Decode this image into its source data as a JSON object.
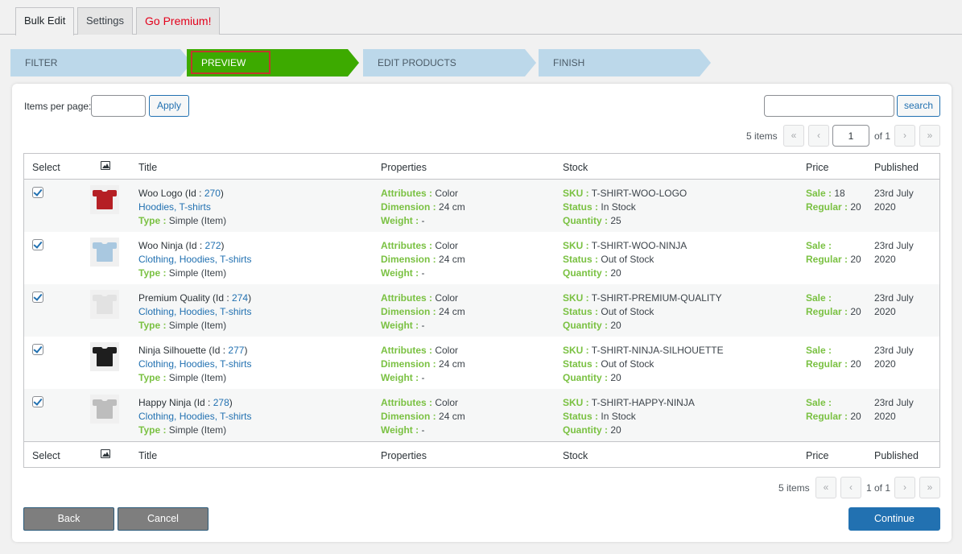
{
  "tabs": [
    {
      "label": "Bulk Edit",
      "active": true
    },
    {
      "label": "Settings",
      "active": false
    },
    {
      "label": "Go Premium!",
      "active": false
    }
  ],
  "steps": [
    {
      "label": "FILTER",
      "state": "inactive"
    },
    {
      "label": "PREVIEW",
      "state": "active"
    },
    {
      "label": "EDIT PRODUCTS",
      "state": "inactive"
    },
    {
      "label": "FINISH",
      "state": "inactive"
    }
  ],
  "controls": {
    "items_per_page_label": "Items per page:",
    "items_per_page_value": "",
    "apply_label": "Apply",
    "search_value": "",
    "search_label": "search"
  },
  "pagination_top": {
    "count": "5 items",
    "first": "«",
    "prev": "‹",
    "page_value": "1",
    "of_text": "of 1",
    "next": "›",
    "last": "»"
  },
  "pagination_bottom": {
    "count": "5 items",
    "first": "«",
    "prev": "‹",
    "page_text": "1 of 1",
    "next": "›",
    "last": "»"
  },
  "table": {
    "headers": {
      "select": "Select",
      "image_icon": "image-icon",
      "title": "Title",
      "properties": "Properties",
      "stock": "Stock",
      "price": "Price",
      "published": "Published"
    },
    "labels": {
      "id_open": "(Id : ",
      "id_close": ")",
      "type": "Type :",
      "attributes": "Attributes :",
      "dimension": "Dimension :",
      "weight": "Weight :",
      "sku": "SKU :",
      "status": "Status :",
      "quantity": "Quantity :",
      "sale": "Sale :",
      "regular": "Regular :"
    },
    "rows": [
      {
        "checked": true,
        "shirt_color": "#b51f24",
        "name": "Woo Logo",
        "id": "270",
        "categories": "Hoodies, T-shirts",
        "type": "Simple (Item)",
        "attributes": "Color",
        "dimension": "24 cm",
        "weight": "-",
        "sku": "T-SHIRT-WOO-LOGO",
        "status": "In Stock",
        "quantity": "25",
        "sale": "18",
        "regular": "20",
        "published_date": "23rd July",
        "published_year": "2020"
      },
      {
        "checked": true,
        "shirt_color": "#a9c8e0",
        "name": "Woo Ninja",
        "id": "272",
        "categories": "Clothing, Hoodies, T-shirts",
        "type": "Simple (Item)",
        "attributes": "Color",
        "dimension": "24 cm",
        "weight": "-",
        "sku": "T-SHIRT-WOO-NINJA",
        "status": "Out of Stock",
        "quantity": "20",
        "sale": "",
        "regular": "20",
        "published_date": "23rd July",
        "published_year": "2020"
      },
      {
        "checked": true,
        "shirt_color": "#e2e2e2",
        "name": "Premium Quality",
        "id": "274",
        "categories": "Clothing, Hoodies, T-shirts",
        "type": "Simple (Item)",
        "attributes": "Color",
        "dimension": "24 cm",
        "weight": "-",
        "sku": "T-SHIRT-PREMIUM-QUALITY",
        "status": "Out of Stock",
        "quantity": "20",
        "sale": "",
        "regular": "20",
        "published_date": "23rd July",
        "published_year": "2020"
      },
      {
        "checked": true,
        "shirt_color": "#1e1e1e",
        "name": "Ninja Silhouette",
        "id": "277",
        "categories": "Clothing, Hoodies, T-shirts",
        "type": "Simple (Item)",
        "attributes": "Color",
        "dimension": "24 cm",
        "weight": "-",
        "sku": "T-SHIRT-NINJA-SILHOUETTE",
        "status": "Out of Stock",
        "quantity": "20",
        "sale": "",
        "regular": "20",
        "published_date": "23rd July",
        "published_year": "2020"
      },
      {
        "checked": true,
        "shirt_color": "#bdbdbd",
        "name": "Happy Ninja",
        "id": "278",
        "categories": "Clothing, Hoodies, T-shirts",
        "type": "Simple (Item)",
        "attributes": "Color",
        "dimension": "24 cm",
        "weight": "-",
        "sku": "T-SHIRT-HAPPY-NINJA",
        "status": "In Stock",
        "quantity": "20",
        "sale": "",
        "regular": "20",
        "published_date": "23rd July",
        "published_year": "2020"
      }
    ]
  },
  "footer_buttons": {
    "back": "Back",
    "cancel": "Cancel",
    "continue": "Continue"
  }
}
